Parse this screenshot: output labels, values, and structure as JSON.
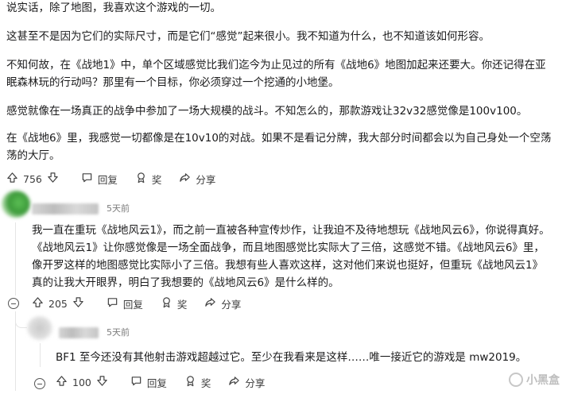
{
  "post": {
    "paragraphs": [
      "说实话，除了地图，我喜欢这个游戏的一切。",
      "这甚至不是因为它们的实际尺寸，而是它们“感觉”起来很小。我不知道为什么，也不知道该如何形容。",
      "不知何故，在《战地1》中，单个区域感觉比我们迄今为止见过的所有《战地6》地图加起来还要大。你还记得在亚眠森林玩的行动吗？那里有一个目标，你必须穿过一个挖通的小地堡。",
      "感觉就像在一场真正的战争中参加了一场大规模的战斗。不知怎么的，那款游戏让32v32感觉像是100v100。",
      "在《战地6》里，我感觉一切都像是在10v10的对战。如果不是看记分牌，我大部分时间都会以为自己身处一个空荡荡的大厅。"
    ],
    "votes": "756",
    "reply_label": "回复",
    "award_label": "奖",
    "share_label": "分享"
  },
  "comment1": {
    "time": "5天前",
    "text": "我一直在重玩《战地风云1》，而之前一直被各种宣传炒作，让我迫不及待地想玩《战地风云6》，你说得真好。《战地风云1》让你感觉像是一场全面战争，而且地图感觉比实际大了三倍，这感觉不错。《战地风云6》里，像开罗这样的地图感觉比实际小了三倍。我想有些人喜欢这样，这对他们来说也挺好，但重玩《战地风云1》真的让我大开眼界，明白了我想要的《战地风云6》是什么样的。",
    "votes": "205",
    "reply_label": "回复",
    "award_label": "奖",
    "share_label": "分享"
  },
  "comment2": {
    "time": "5天前",
    "text": "BF1 至今还没有其他射击游戏超越过它。至少在我看来是这样……唯一接近它的游戏是 mw2019。",
    "votes": "100",
    "reply_label": "回复",
    "award_label": "奖",
    "share_label": "分享"
  },
  "watermark": {
    "text": "小黑盒"
  },
  "colors": {
    "avatar_green": "#4caf50",
    "text": "#1a1a1b",
    "muted": "#7c7c7c"
  },
  "icons": [
    "upvote-icon",
    "downvote-icon",
    "reply-icon",
    "award-icon",
    "share-icon",
    "collapse-icon"
  ]
}
